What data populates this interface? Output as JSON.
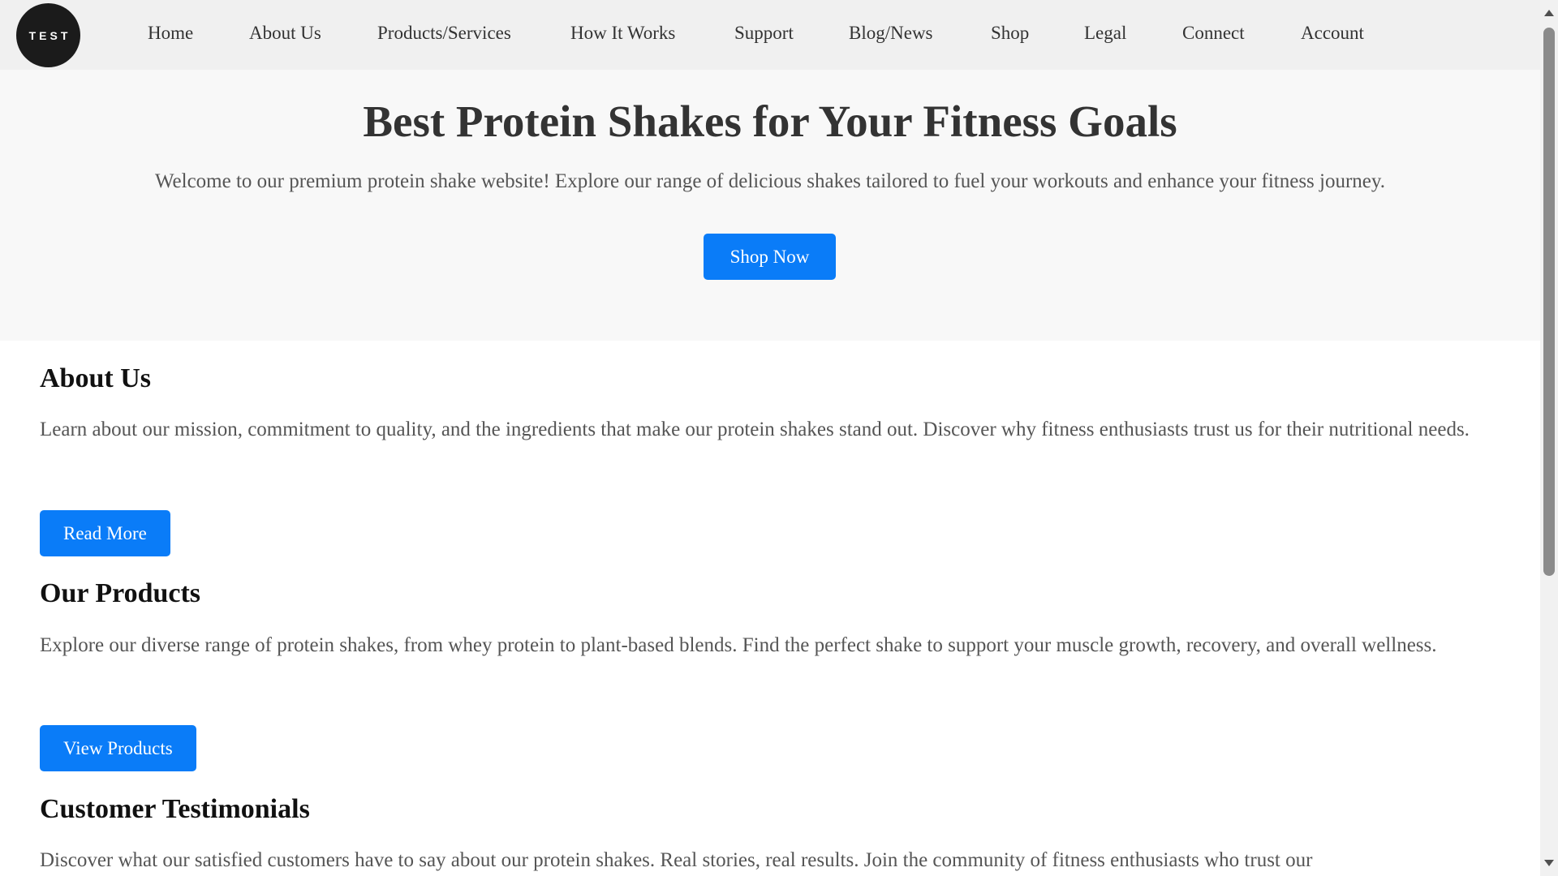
{
  "logo": {
    "text": "TEST"
  },
  "nav": {
    "items": [
      {
        "label": "Home"
      },
      {
        "label": "About Us"
      },
      {
        "label": "Products/Services"
      },
      {
        "label": "How It Works"
      },
      {
        "label": "Support"
      },
      {
        "label": "Blog/News"
      },
      {
        "label": "Shop"
      },
      {
        "label": "Legal"
      },
      {
        "label": "Connect"
      },
      {
        "label": "Account"
      }
    ]
  },
  "hero": {
    "title": "Best Protein Shakes for Your Fitness Goals",
    "text": "Welcome to our premium protein shake website! Explore our range of delicious shakes tailored to fuel your workouts and enhance your fitness journey.",
    "button_label": "Shop Now"
  },
  "sections": [
    {
      "heading": "About Us",
      "text": "Learn about our mission, commitment to quality, and the ingredients that make our protein shakes stand out. Discover why fitness enthusiasts trust us for their nutritional needs.",
      "button_label": "Read More"
    },
    {
      "heading": "Our Products",
      "text": "Explore our diverse range of protein shakes, from whey protein to plant-based blends. Find the perfect shake to support your muscle growth, recovery, and overall wellness.",
      "button_label": "View Products"
    },
    {
      "heading": "Customer Testimonials",
      "text": "Discover what our satisfied customers have to say about our protein shakes. Real stories, real results. Join the community of fitness enthusiasts who trust our"
    }
  ],
  "colors": {
    "accent": "#0a7cf8",
    "header_bg": "#f0f0f0",
    "hero_bg": "#f8f8f8",
    "logo_bg": "#1b1b1b"
  }
}
